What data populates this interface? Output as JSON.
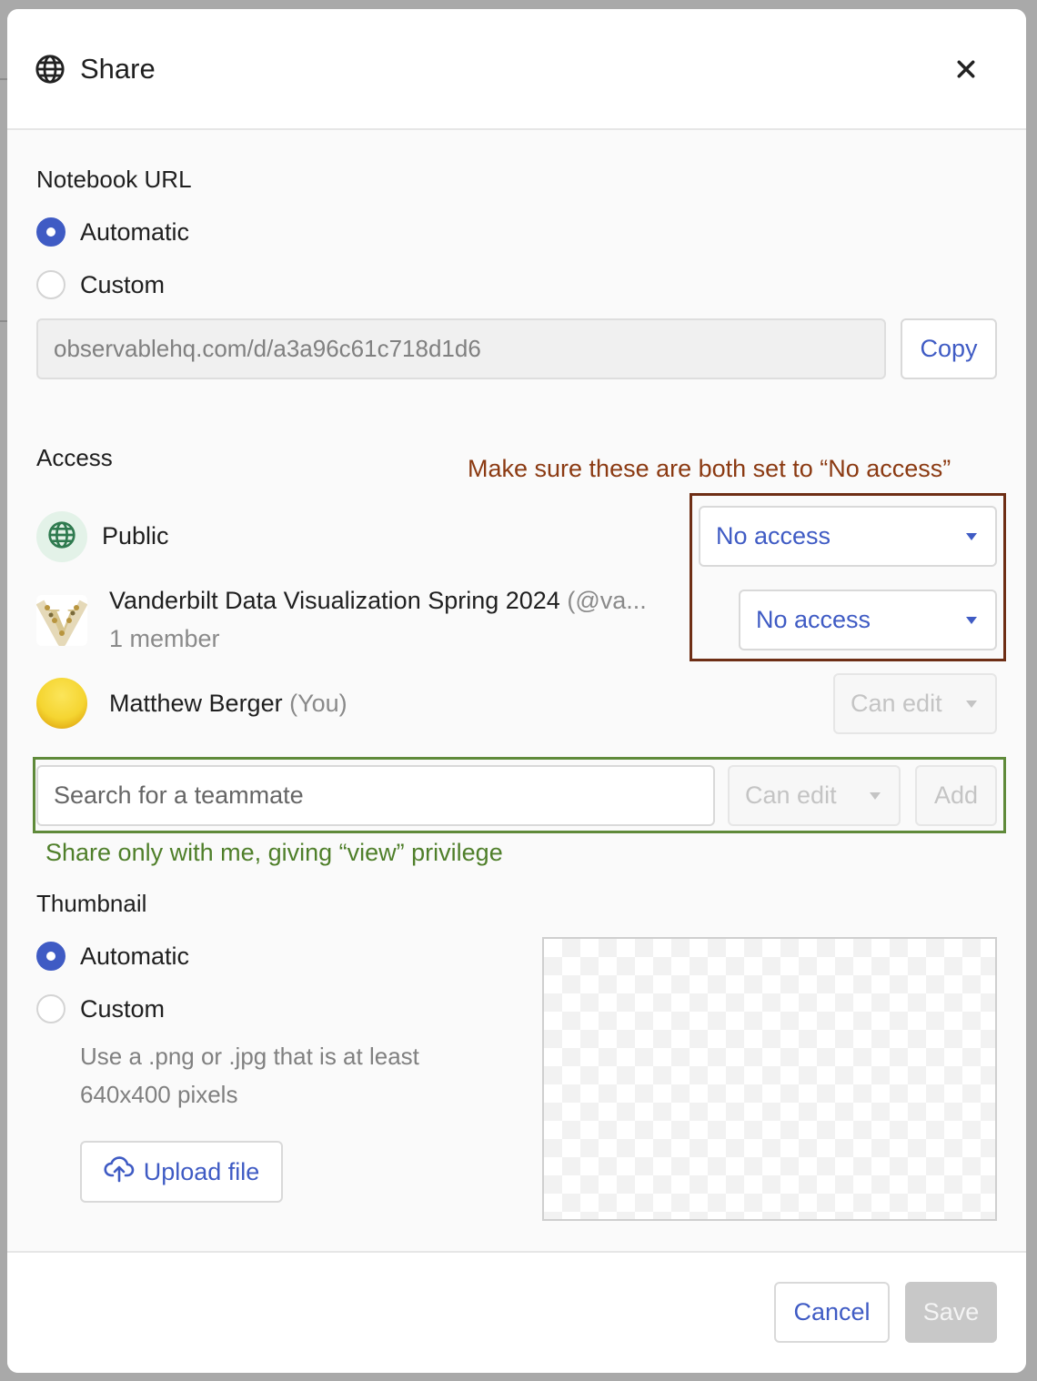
{
  "dialog": {
    "title": "Share",
    "title_icon": "globe-icon",
    "close_icon": "close-icon"
  },
  "notebook_url": {
    "heading": "Notebook URL",
    "options": [
      {
        "label": "Automatic",
        "selected": true
      },
      {
        "label": "Custom",
        "selected": false
      }
    ],
    "url_value": "observablehq.com/d/a3a96c61c718d1d6",
    "copy_label": "Copy"
  },
  "access": {
    "heading": "Access",
    "annotation": "Make sure these are both set to “No access”",
    "public": {
      "name": "Public",
      "icon": "globe-icon",
      "permission": "No access"
    },
    "team": {
      "name": "Vanderbilt Data Visualization Spring 2024",
      "handle": "(@va...",
      "members": "1 member",
      "avatar_letter": "V",
      "permission": "No access"
    },
    "owner": {
      "name": "Matthew Berger",
      "suffix": "(You)",
      "permission": "Can edit"
    },
    "invite": {
      "placeholder": "Search for a teammate",
      "permission": "Can edit",
      "add_label": "Add"
    },
    "invite_annotation": "Share only with me, giving “view” privilege"
  },
  "thumbnail": {
    "heading": "Thumbnail",
    "options": [
      {
        "label": "Automatic",
        "selected": true
      },
      {
        "label": "Custom",
        "selected": false
      }
    ],
    "hint": "Use a .png or .jpg that is at least 640x400 pixels",
    "upload_label": "Upload file",
    "upload_icon": "cloud-upload-icon"
  },
  "footer": {
    "cancel_label": "Cancel",
    "save_label": "Save"
  },
  "colors": {
    "accent": "#3f5bc4",
    "annotation_brown": "#8b3a12",
    "annotation_green": "#4f7f2a"
  }
}
